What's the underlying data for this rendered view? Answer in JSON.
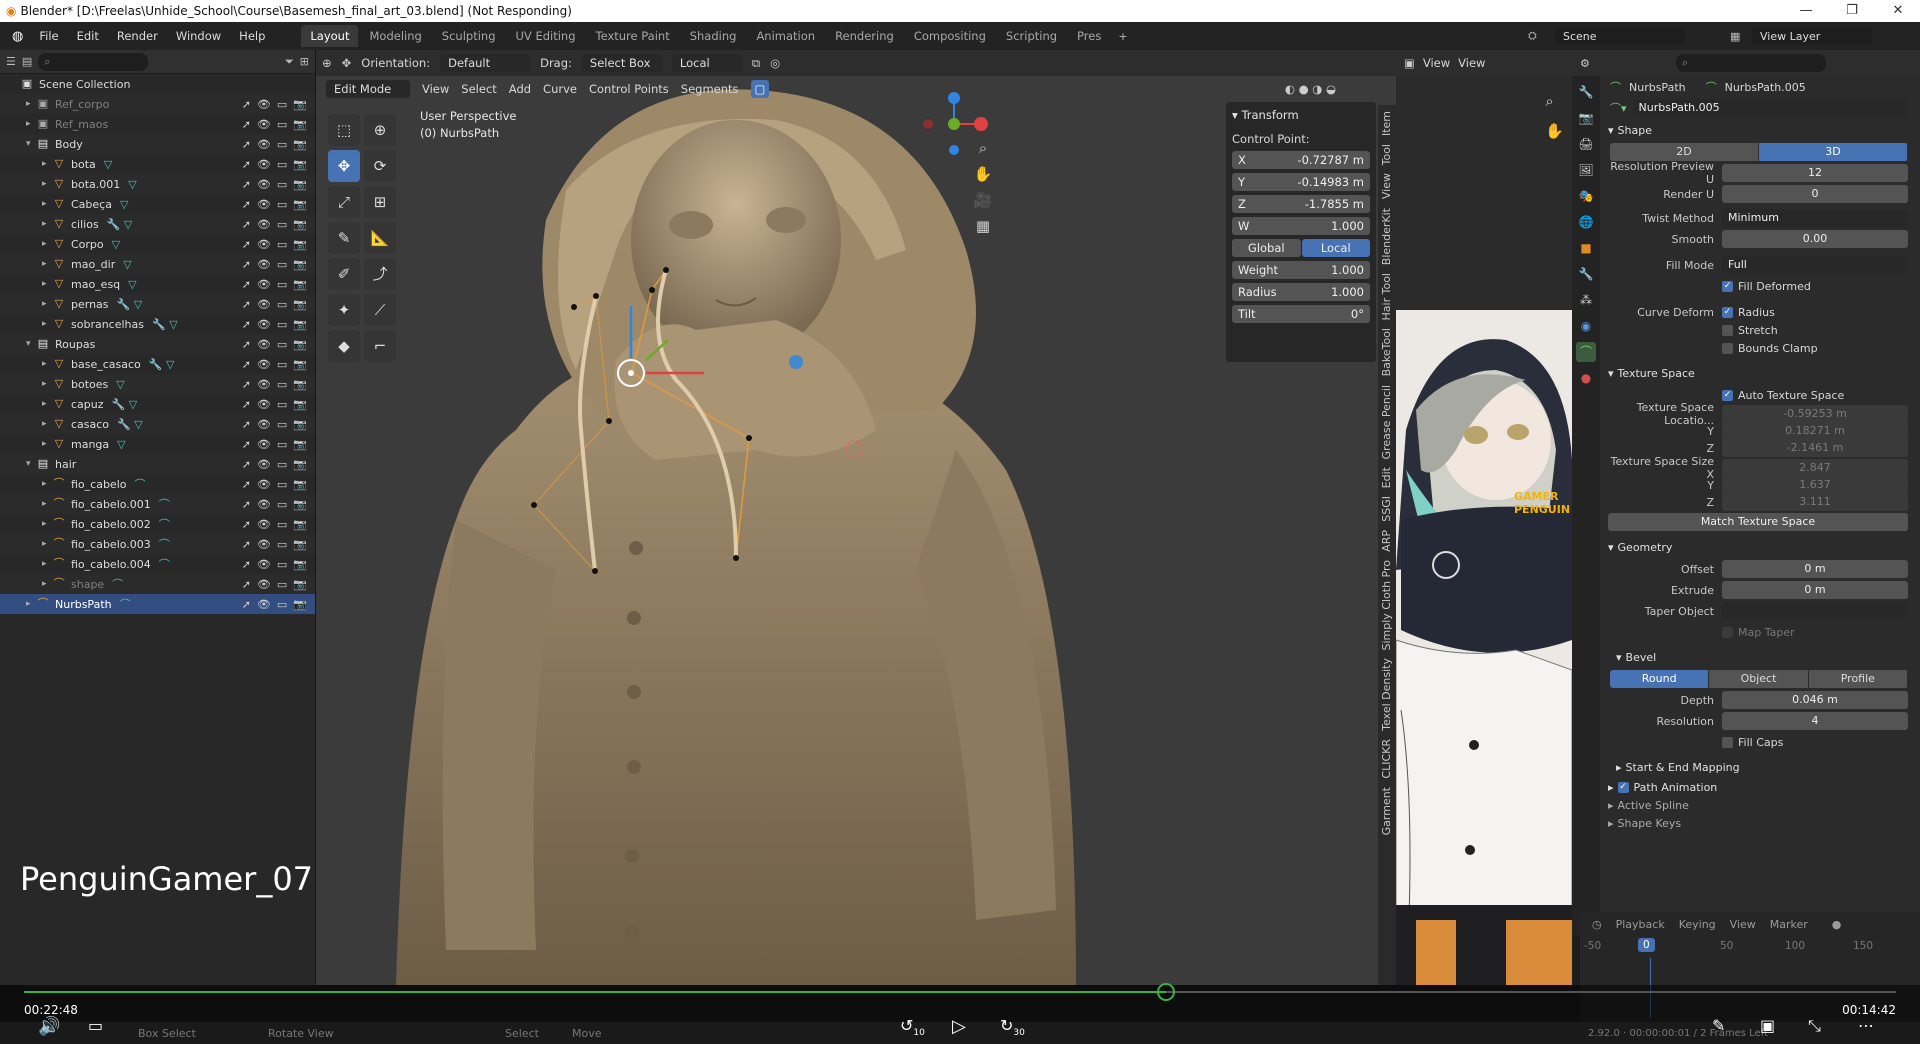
{
  "window": {
    "title": "Blender* [D:\\Freelas\\Unhide_School\\Course\\Basemesh_final_art_03.blend] (Not Responding)"
  },
  "menus": [
    "File",
    "Edit",
    "Render",
    "Window",
    "Help"
  ],
  "workspaces": [
    "Layout",
    "Modeling",
    "Sculpting",
    "UV Editing",
    "Texture Paint",
    "Shading",
    "Animation",
    "Rendering",
    "Compositing",
    "Scripting",
    "Pres"
  ],
  "scene": {
    "name": "Scene",
    "view_layer": "View Layer"
  },
  "outliner": {
    "root": "Scene Collection",
    "rows": [
      {
        "label": "Ref_corpo",
        "indent": 1,
        "icon": "image",
        "dim": true
      },
      {
        "label": "Ref_maos",
        "indent": 1,
        "icon": "image",
        "dim": true
      },
      {
        "label": "Body",
        "indent": 1,
        "icon": "collection",
        "expanded": true
      },
      {
        "label": "bota",
        "indent": 2,
        "icon": "mesh",
        "mods": "▽"
      },
      {
        "label": "bota.001",
        "indent": 2,
        "icon": "mesh",
        "mods": "▽"
      },
      {
        "label": "Cabeça",
        "indent": 2,
        "icon": "mesh",
        "mods": "▽"
      },
      {
        "label": "cilios",
        "indent": 2,
        "icon": "mesh",
        "mods": "🔧 ▽"
      },
      {
        "label": "Corpo",
        "indent": 2,
        "icon": "mesh",
        "mods": "▽"
      },
      {
        "label": "mao_dir",
        "indent": 2,
        "icon": "mesh",
        "mods": "▽"
      },
      {
        "label": "mao_esq",
        "indent": 2,
        "icon": "mesh",
        "mods": "▽"
      },
      {
        "label": "pernas",
        "indent": 2,
        "icon": "mesh",
        "mods": "🔧 ▽"
      },
      {
        "label": "sobrancelhas",
        "indent": 2,
        "icon": "mesh",
        "mods": "🔧 ▽"
      },
      {
        "label": "Roupas",
        "indent": 1,
        "icon": "collection",
        "expanded": true
      },
      {
        "label": "base_casaco",
        "indent": 2,
        "icon": "mesh",
        "mods": "🔧 ▽"
      },
      {
        "label": "botoes",
        "indent": 2,
        "icon": "mesh",
        "mods": "▽"
      },
      {
        "label": "capuz",
        "indent": 2,
        "icon": "mesh",
        "mods": "🔧 ▽"
      },
      {
        "label": "casaco",
        "indent": 2,
        "icon": "mesh",
        "mods": "🔧 ▽"
      },
      {
        "label": "manga",
        "indent": 2,
        "icon": "mesh",
        "mods": "▽"
      },
      {
        "label": "hair",
        "indent": 1,
        "icon": "collection",
        "expanded": true
      },
      {
        "label": "fio_cabelo",
        "indent": 2,
        "icon": "curve",
        "mods": "⌒"
      },
      {
        "label": "fio_cabelo.001",
        "indent": 2,
        "icon": "curve",
        "mods": "⌒"
      },
      {
        "label": "fio_cabelo.002",
        "indent": 2,
        "icon": "curve",
        "mods": "⌒"
      },
      {
        "label": "fio_cabelo.003",
        "indent": 2,
        "icon": "curve",
        "mods": "⌒"
      },
      {
        "label": "fio_cabelo.004",
        "indent": 2,
        "icon": "curve",
        "mods": "⌒"
      },
      {
        "label": "shape",
        "indent": 2,
        "icon": "curve",
        "mods": "⌒",
        "dim": true
      },
      {
        "label": "NurbsPath",
        "indent": 1,
        "icon": "curve",
        "mods": "⌒",
        "selected": true
      }
    ]
  },
  "viewport": {
    "header": {
      "orientation_label": "Orientation:",
      "orientation": "Default",
      "drag_label": "Drag:",
      "drag": "Select Box",
      "pivot": "Local"
    },
    "header2": {
      "mode": "Edit Mode",
      "items": [
        "View",
        "Select",
        "Add",
        "Curve",
        "Control Points",
        "Segments"
      ]
    },
    "info_line1": "User Perspective",
    "info_line2": "(0) NurbsPath",
    "transform": {
      "title": "Transform",
      "section": "Control Point:",
      "x": "-0.72787 m",
      "y": "-0.14983 m",
      "z": "-1.7855 m",
      "w": "1.000",
      "global": "Global",
      "local": "Local",
      "weight": "1.000",
      "radius": "1.000",
      "tilt": "0°"
    },
    "side_tabs": [
      "Item",
      "Tool",
      "View",
      "BlenderKit",
      "Hair Tool",
      "BakeTool",
      "Grease Pencil",
      "Edit",
      "SSGI",
      "ARP",
      "Simply Cloth Pro",
      "Texel Density",
      "CLICKR",
      "Garment"
    ],
    "header_right": {
      "view1": "View",
      "view2": "View"
    }
  },
  "reference": {
    "hood_text": "GAMER PENGUIN"
  },
  "properties": {
    "object": "NurbsPath",
    "data": "NurbsPath.005",
    "datablock": "NurbsPath.005",
    "shape": {
      "title": "Shape",
      "mode_2d": "2D",
      "mode_3d": "3D",
      "res_preview_label": "Resolution Preview U",
      "res_preview": "12",
      "render_u_label": "Render U",
      "render_u": "0",
      "twist_label": "Twist Method",
      "twist": "Minimum",
      "smooth_label": "Smooth",
      "smooth": "0.00",
      "fill_label": "Fill Mode",
      "fill": "Full",
      "fill_deformed": "Fill Deformed",
      "deform_label": "Curve Deform",
      "radius": "Radius",
      "stretch": "Stretch",
      "bounds": "Bounds Clamp"
    },
    "texture_space": {
      "title": "Texture Space",
      "auto": "Auto Texture Space",
      "loc_label": "Texture Space Locatio...",
      "loc_x": "-0.59253 m",
      "loc_y_label": "Y",
      "loc_y": "0.18271 m",
      "loc_z_label": "Z",
      "loc_z": "-2.1461 m",
      "size_label": "Texture Space Size X",
      "size_x": "2.847",
      "size_y_label": "Y",
      "size_y": "1.637",
      "size_z_label": "Z",
      "size_z": "3.111",
      "match": "Match Texture Space"
    },
    "geometry": {
      "title": "Geometry",
      "offset_label": "Offset",
      "offset": "0 m",
      "extrude_label": "Extrude",
      "extrude": "0 m",
      "taper_label": "Taper Object",
      "taper": "",
      "map_taper": "Map Taper"
    },
    "bevel": {
      "title": "Bevel",
      "round": "Round",
      "object": "Object",
      "profile": "Profile",
      "depth_label": "Depth",
      "depth": "0.046 m",
      "res_label": "Resolution",
      "res": "4",
      "fill_caps": "Fill Caps"
    },
    "collapsed": [
      "Start & End Mapping",
      "Path Animation",
      "Active Spline",
      "Shape Keys"
    ]
  },
  "timeline": {
    "items": [
      "Playback",
      "Keying",
      "View",
      "Marker"
    ],
    "ticks": [
      "-50",
      "0",
      "50",
      "100",
      "150"
    ],
    "current": "0",
    "version": "2.92.0 · 00:00:00:01 / 2 Frames Left"
  },
  "video": {
    "title": "PenguinGamer_07",
    "elapsed": "00:22:48",
    "remaining": "00:14:42",
    "rewind": "10",
    "forward": "30",
    "progress": 0.61
  },
  "status": {
    "items": [
      "Box Select",
      "Rotate View",
      "Select",
      "Move"
    ]
  },
  "colors": {
    "accent": "#4772b3",
    "selection": "#334d80",
    "x_axis": "#e04242",
    "y_axis": "#6aab28",
    "z_axis": "#2f86e0",
    "progress": "#3cb043"
  }
}
